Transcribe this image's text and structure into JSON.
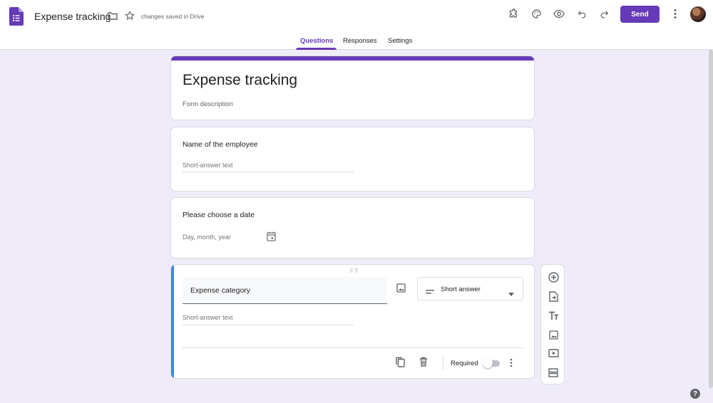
{
  "header": {
    "title": "Expense tracking",
    "save_status": "changes saved in Drive",
    "send_label": "Send",
    "icons": [
      "forms-app-icon",
      "folder-icon",
      "star-icon",
      "puzzle-addon-icon",
      "palette-icon",
      "preview-eye-icon",
      "undo-icon",
      "redo-icon",
      "more-vert-icon"
    ]
  },
  "tabs": [
    {
      "label": "Questions",
      "active": true
    },
    {
      "label": "Responses",
      "active": false
    },
    {
      "label": "Settings",
      "active": false
    }
  ],
  "form": {
    "title": "Expense tracking",
    "description_placeholder": "Form description"
  },
  "questions": [
    {
      "title": "Name of the employee",
      "hint": "Short-answer text"
    },
    {
      "title": "Please choose a date",
      "hint": "Day, month, year"
    },
    {
      "title": "Expense category",
      "type": "Short answer",
      "hint": "Short-answer text",
      "required_label": "Required",
      "required": false
    }
  ],
  "side_toolbar": [
    "add-question-icon",
    "import-questions-icon",
    "add-title-icon",
    "add-image-icon",
    "add-video-icon",
    "add-section-icon"
  ],
  "colors": {
    "accent": "#673ab7",
    "background": "#f0ebf8",
    "active_question": "#4285f4"
  }
}
